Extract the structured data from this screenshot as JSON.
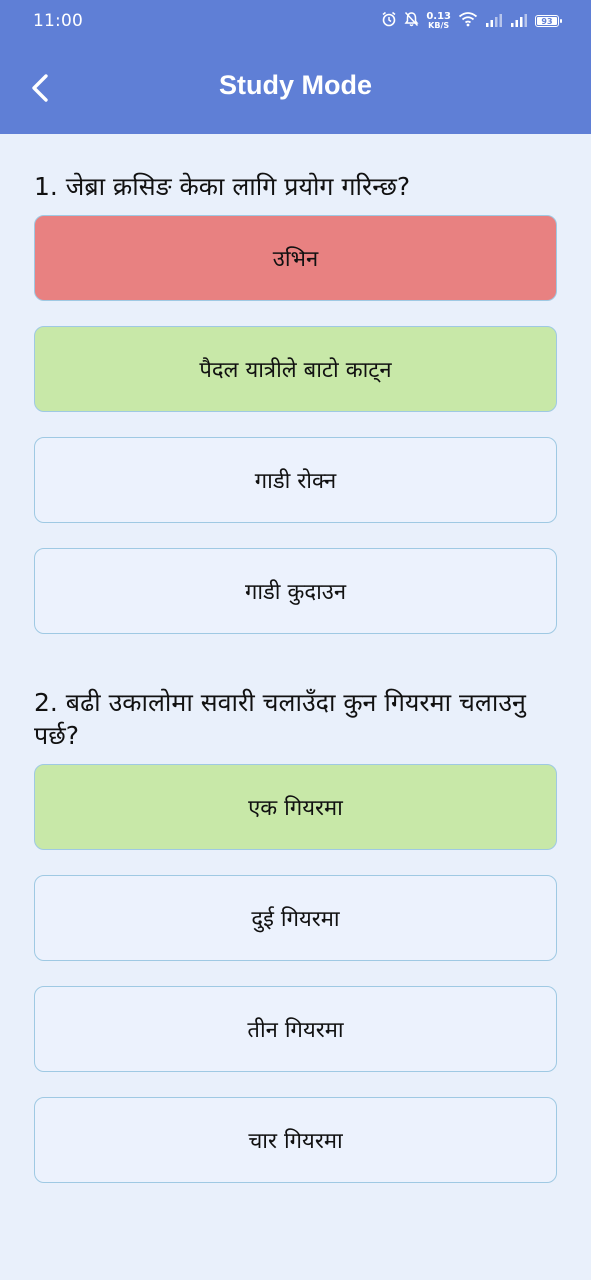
{
  "status_bar": {
    "time": "11:00",
    "net_speed_value": "0.13",
    "net_speed_unit": "KB/S",
    "battery": "93"
  },
  "header": {
    "title": "Study Mode"
  },
  "questions": [
    {
      "text": "1. जेब्रा क्रसिङ केका लागि प्रयोग गरिन्छ?",
      "options": [
        {
          "label": "उभिन",
          "state": "wrong"
        },
        {
          "label": "पैदल यात्रीले बाटो काट्न",
          "state": "correct"
        },
        {
          "label": "गाडी रोक्न",
          "state": "neutral"
        },
        {
          "label": "गाडी कुदाउन",
          "state": "neutral"
        }
      ]
    },
    {
      "text": "2. बढी उकालोमा सवारी चलाउँदा कुन गियरमा चलाउनु पर्छ?",
      "options": [
        {
          "label": "एक गियरमा",
          "state": "correct"
        },
        {
          "label": "दुई गियरमा",
          "state": "neutral"
        },
        {
          "label": "तीन गियरमा",
          "state": "neutral"
        },
        {
          "label": "चार गियरमा",
          "state": "neutral"
        }
      ]
    }
  ],
  "colors": {
    "header": "#5f7fd6",
    "background": "#e9f0fb",
    "wrong": "#e88181",
    "correct": "#c8e8a8",
    "option_border": "#9fc9e3"
  }
}
